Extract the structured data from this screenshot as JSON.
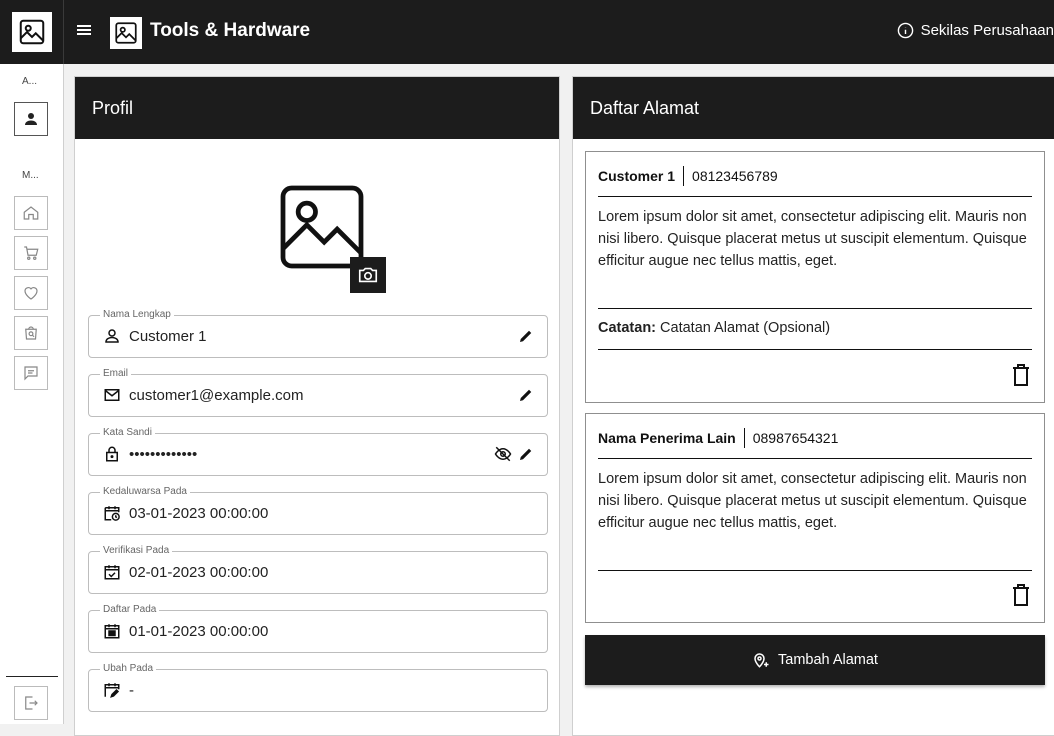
{
  "app": {
    "title": "Tools & Hardware",
    "company_link": "Sekilas Perusahaan"
  },
  "rail": {
    "section_a": "A...",
    "section_m": "M...",
    "items": [
      "account-icon",
      "home-icon",
      "cart-icon",
      "heart-icon",
      "bag-search-icon",
      "chat-icon",
      "logout-icon"
    ]
  },
  "profile": {
    "header": "Profil",
    "fields": [
      {
        "label": "Nama Lengkap",
        "value": "Customer 1",
        "icon": "person-icon"
      },
      {
        "label": "Email",
        "value": "customer1@example.com",
        "icon": "mail-icon"
      },
      {
        "label": "Kata Sandi",
        "value": "•••••••••••••",
        "icon": "lock-icon"
      },
      {
        "label": "Kedaluwarsa Pada",
        "value": "03-01-2023 00:00:00",
        "icon": "calendar-clock-icon"
      },
      {
        "label": "Verifikasi Pada",
        "value": "02-01-2023 00:00:00",
        "icon": "calendar-check-icon"
      },
      {
        "label": "Daftar Pada",
        "value": "01-01-2023 00:00:00",
        "icon": "calendar-today-icon"
      },
      {
        "label": "Ubah Pada",
        "value": "-",
        "icon": "calendar-edit-icon"
      }
    ]
  },
  "addresses": {
    "header": "Daftar Alamat",
    "items": [
      {
        "name": "Customer 1",
        "phone": "08123456789",
        "text": "Lorem ipsum dolor sit amet, consectetur adipiscing elit. Mauris non nisi libero. Quisque placerat metus ut suscipit elementum. Quisque efficitur augue nec tellus mattis, eget.",
        "note_label": "Catatan:",
        "note": "Catatan Alamat (Opsional)"
      },
      {
        "name": "Nama Penerima Lain",
        "phone": "08987654321",
        "text": "Lorem ipsum dolor sit amet, consectetur adipiscing elit. Mauris non nisi libero. Quisque placerat metus ut suscipit elementum. Quisque efficitur augue nec tellus mattis, eget."
      }
    ],
    "add_label": "Tambah Alamat"
  },
  "colors": {
    "dark": "#1c1c1c",
    "border": "#bdbdbd",
    "accent": "#ffffff"
  }
}
